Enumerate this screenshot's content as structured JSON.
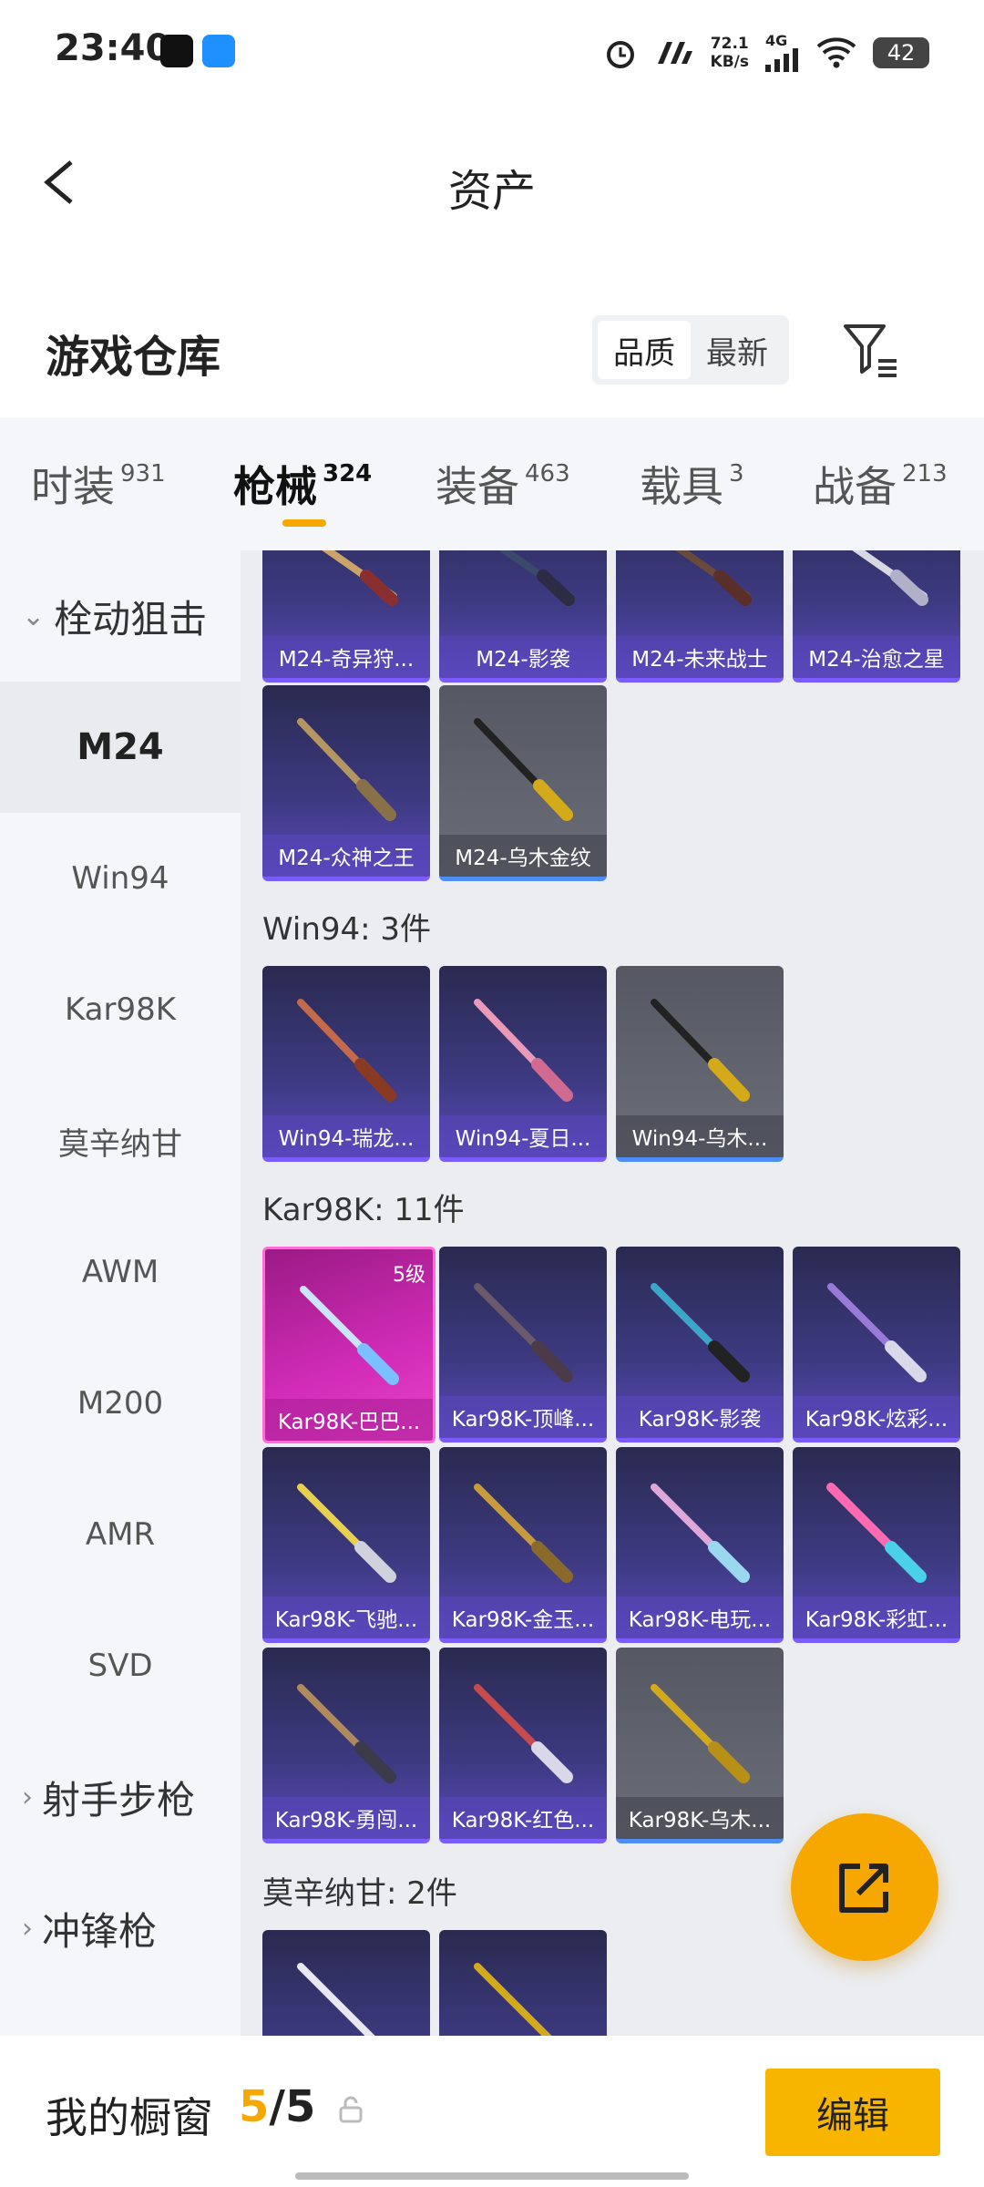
{
  "status": {
    "time": "23:40",
    "speed_value": "72.1",
    "speed_unit": "KB/s",
    "network": "4G",
    "battery": "42"
  },
  "header": {
    "title": "资产"
  },
  "warehouse": {
    "title": "游戏仓库",
    "sort_quality": "品质",
    "sort_newest": "最新"
  },
  "tabs": [
    {
      "label": "时装",
      "count": "931"
    },
    {
      "label": "枪械",
      "count": "324"
    },
    {
      "label": "装备",
      "count": "463"
    },
    {
      "label": "载具",
      "count": "3"
    },
    {
      "label": "战备",
      "count": "213"
    }
  ],
  "sidebar": {
    "cat_bolt": "栓动狙击",
    "items": [
      "M24",
      "Win94",
      "Kar98K",
      "莫辛纳甘",
      "AWM",
      "M200",
      "AMR",
      "SVD"
    ],
    "cat_marksman": "射手步枪",
    "cat_smg": "冲锋枪"
  },
  "groups": {
    "m24_cards": [
      "M24-奇异狩...",
      "M24-影袭",
      "M24-未来战士",
      "M24-治愈之星",
      "M24-众神之王",
      "M24-乌木金纹"
    ],
    "win94_title": "Win94: 3件",
    "win94_cards": [
      "Win94-瑞龙...",
      "Win94-夏日...",
      "Win94-乌木..."
    ],
    "kar_title": "Kar98K: 11件",
    "kar_level": "5级",
    "kar_cards": [
      "Kar98K-巴巴...",
      "Kar98K-顶峰...",
      "Kar98K-影袭",
      "Kar98K-炫彩...",
      "Kar98K-飞驰...",
      "Kar98K-金玉...",
      "Kar98K-电玩...",
      "Kar98K-彩虹...",
      "Kar98K-勇闯...",
      "Kar98K-红色...",
      "Kar98K-乌木..."
    ],
    "mosin_title": "莫辛纳甘: 2件"
  },
  "bottom": {
    "title": "我的橱窗",
    "count_current": "5",
    "count_total": "/5",
    "edit": "编辑"
  },
  "icons": [
    "back-icon",
    "filter-icon",
    "share-icon",
    "lock-icon",
    "alarm-icon",
    "wifi-icon",
    "signal-icon"
  ],
  "colors": {
    "accent": "#f5a800",
    "card_purple": "#5a4ab8",
    "card_pink": "#d22cb8"
  }
}
